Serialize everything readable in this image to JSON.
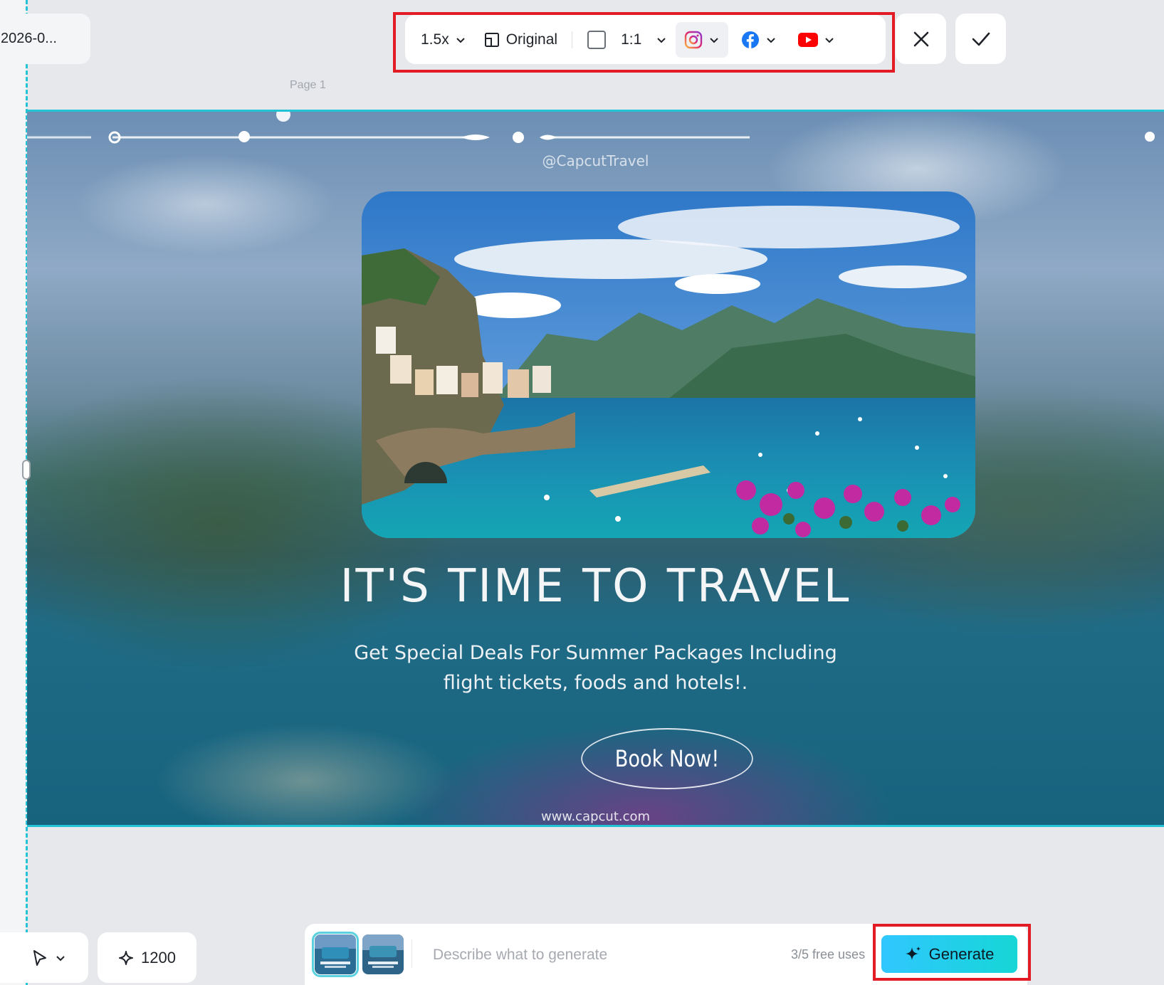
{
  "file": {
    "name": "2026-0..."
  },
  "toolbar": {
    "speed": "1.5x",
    "layout_label": "Original",
    "ratio": "1:1",
    "platforms": [
      "instagram-icon",
      "facebook-icon",
      "youtube-icon"
    ]
  },
  "canvas": {
    "page_label": "Page 1",
    "handle": "@CapcutTravel",
    "headline": "IT'S TIME TO TRAVEL",
    "subline_1": "Get Special Deals For Summer Packages Including",
    "subline_2": "flight tickets, foods and hotels!.",
    "cta": "Book Now!",
    "url": "www.capcut.com"
  },
  "bottom": {
    "credits": "1200",
    "prompt_placeholder": "Describe what to generate",
    "free_uses": "3/5 free uses",
    "generate_label": "Generate"
  },
  "colors": {
    "accent": "#22c3d4",
    "highlight": "#e21b24",
    "generate_start": "#30c7ff",
    "generate_end": "#16d6d6"
  }
}
